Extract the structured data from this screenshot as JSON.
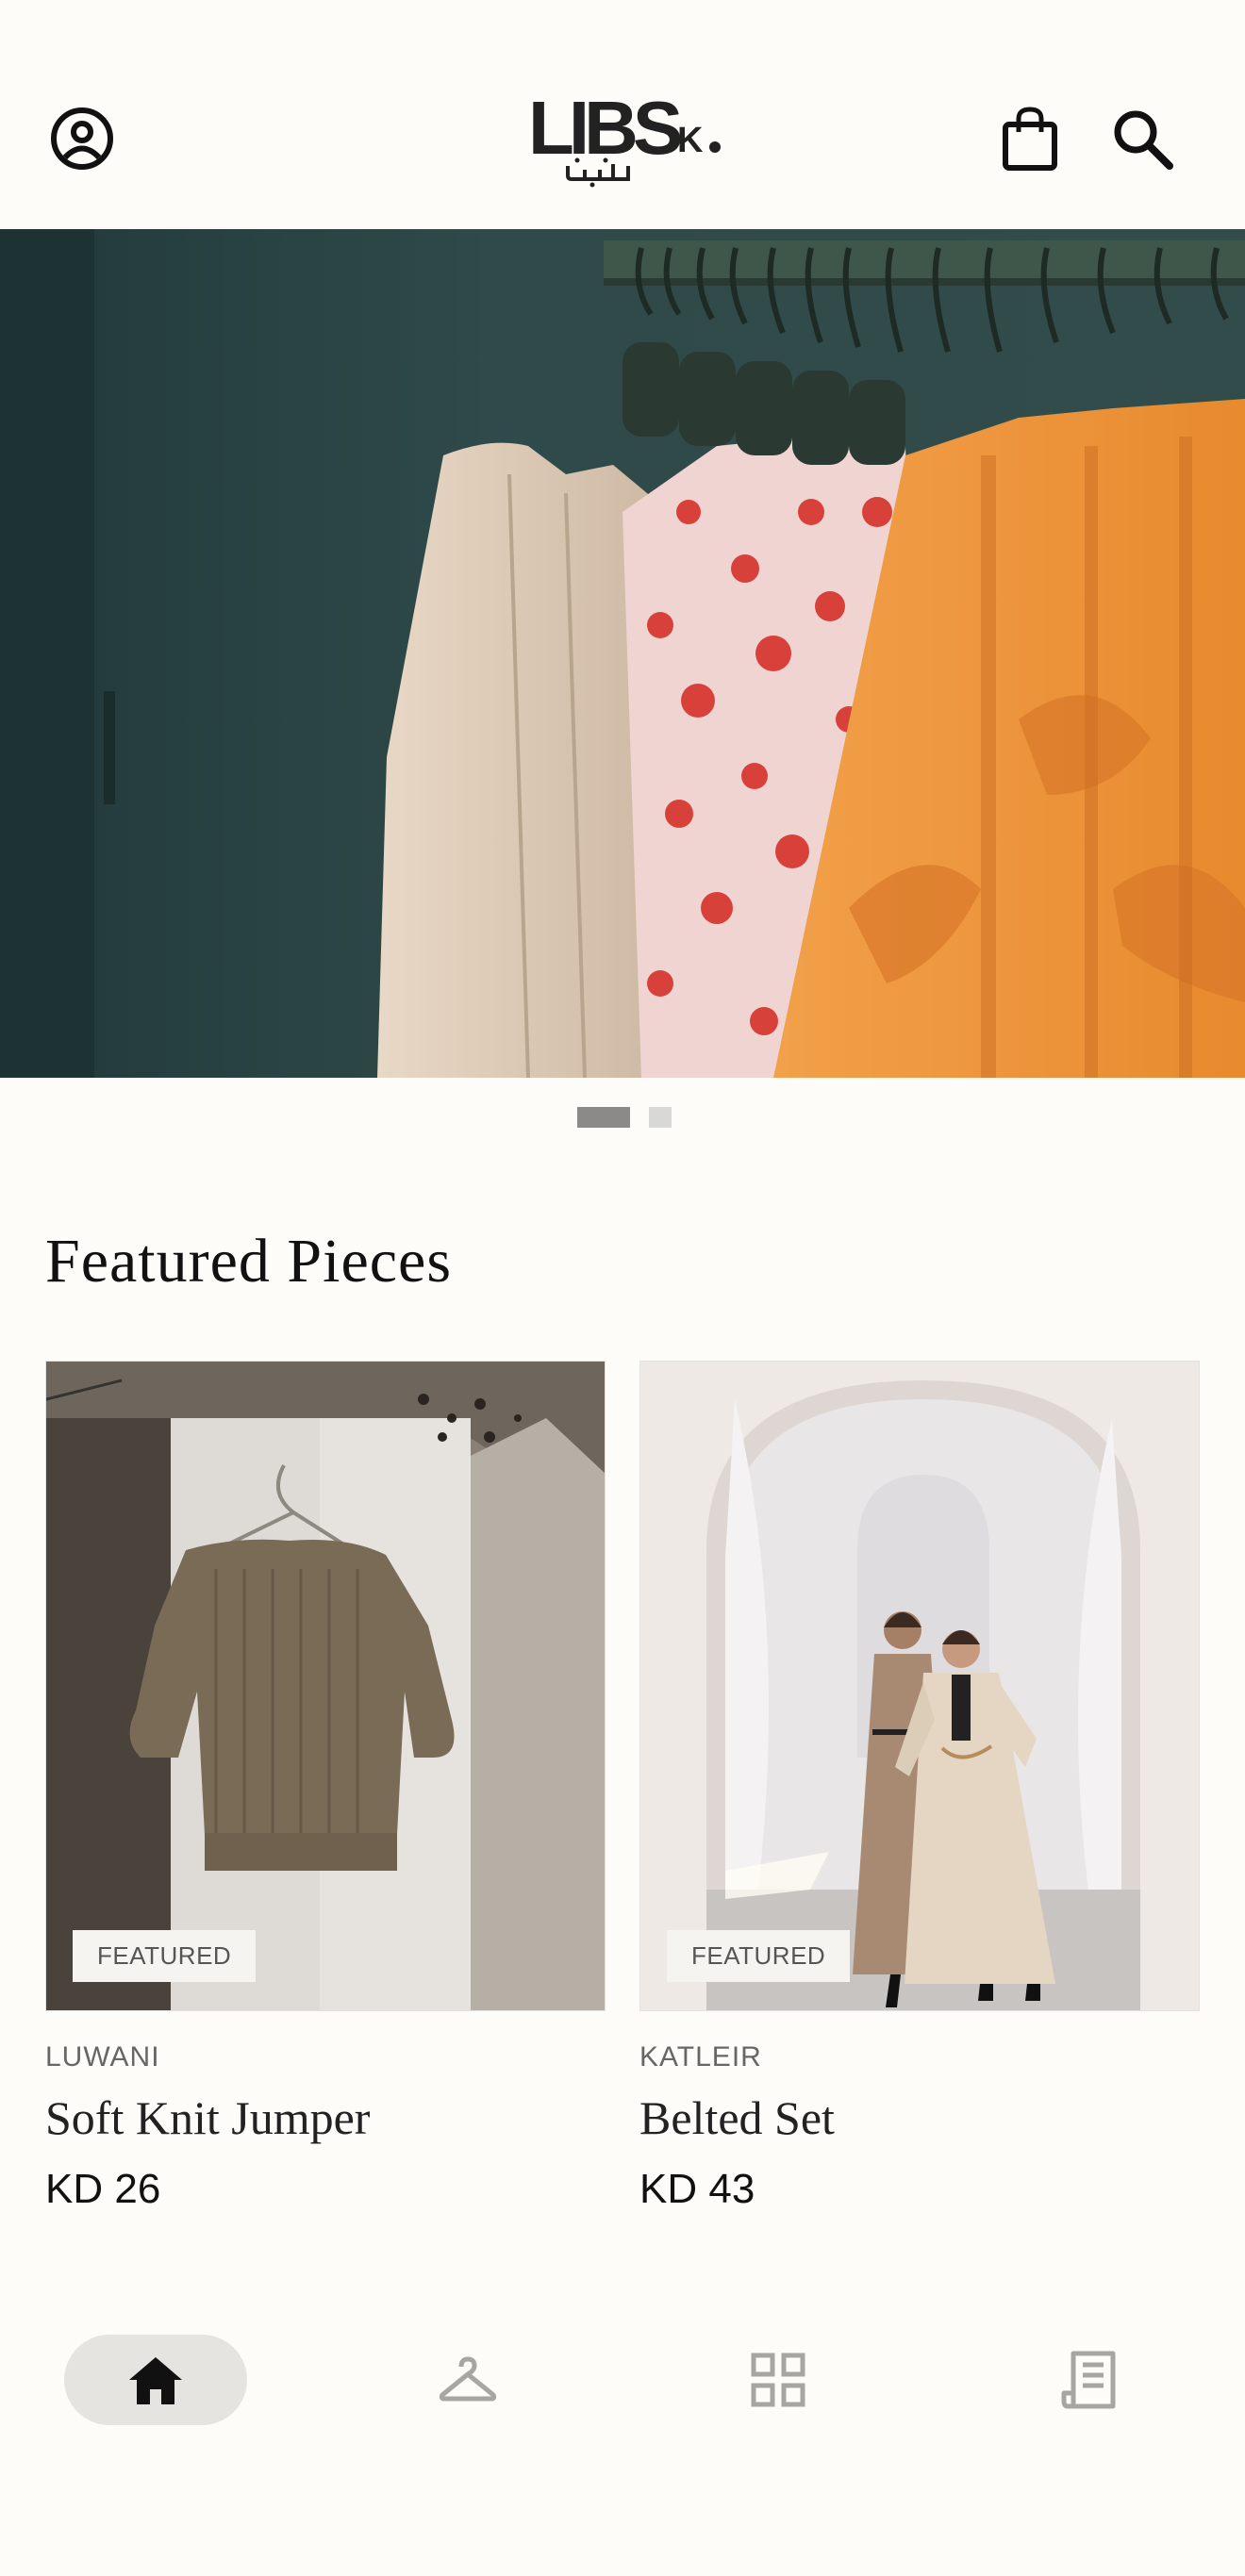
{
  "header": {
    "logo_text": "LIBS",
    "logo_suffix": "K",
    "icons": [
      "account-circle-icon",
      "shopping-bag-icon",
      "search-icon"
    ]
  },
  "hero": {
    "carousel_pages": 2,
    "active_page": 1
  },
  "featured": {
    "title": "Featured Pieces",
    "products": [
      {
        "badge": "FEATURED",
        "brand": "LUWANI",
        "name": "Soft Knit Jumper",
        "price": "KD 26"
      },
      {
        "badge": "FEATURED",
        "brand": "KATLEIR",
        "name": "Belted Set",
        "price": "KD 43"
      }
    ]
  },
  "bottom_nav": {
    "items": [
      "home-icon",
      "hanger-icon",
      "grid-icon",
      "receipt-icon"
    ],
    "active": "home-icon"
  },
  "colors": {
    "background": "#fdfcf8",
    "active_dot": "#8c8a88",
    "inactive_dot": "#d8d8d6",
    "nav_active_bg": "#e6e4e1"
  }
}
